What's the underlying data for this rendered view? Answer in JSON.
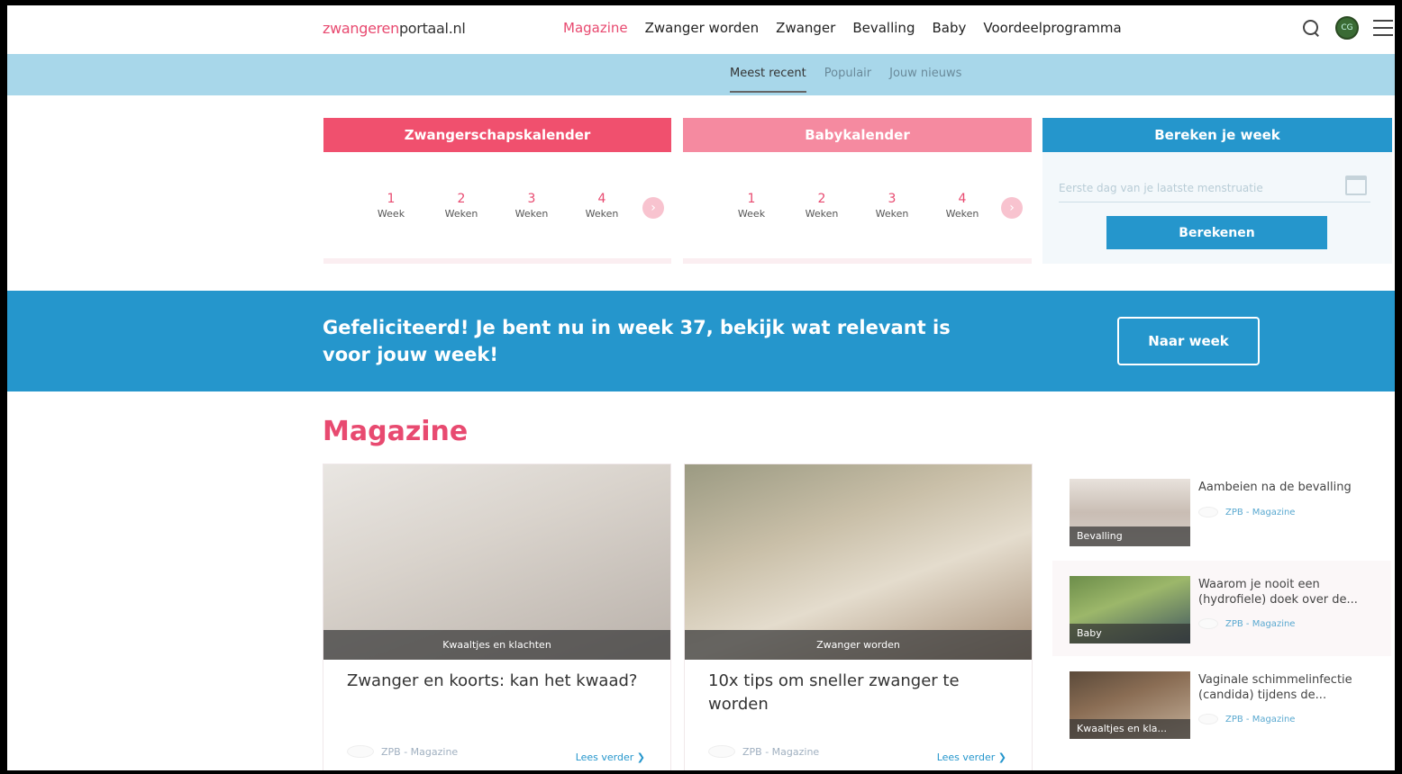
{
  "header": {
    "logo_pink": "zwangeren",
    "logo_dark": "portaal.nl",
    "nav": [
      "Magazine",
      "Zwanger worden",
      "Zwanger",
      "Bevalling",
      "Baby",
      "Voordeelprogramma"
    ],
    "avatar_initials": "CG"
  },
  "subnav": {
    "tabs": [
      "Meest recent",
      "Populair",
      "Jouw nieuws"
    ]
  },
  "pregnancy_calendar": {
    "title": "Zwangerschapskalender",
    "weeks": [
      {
        "num": "1",
        "label": "Week"
      },
      {
        "num": "2",
        "label": "Weken"
      },
      {
        "num": "3",
        "label": "Weken"
      },
      {
        "num": "4",
        "label": "Weken"
      }
    ],
    "next": "›"
  },
  "baby_calendar": {
    "title": "Babykalender",
    "weeks": [
      {
        "num": "1",
        "label": "Week"
      },
      {
        "num": "2",
        "label": "Weken"
      },
      {
        "num": "3",
        "label": "Weken"
      },
      {
        "num": "4",
        "label": "Weken"
      }
    ],
    "next": "›"
  },
  "week_calc": {
    "title": "Bereken je week",
    "placeholder": "Eerste dag van je laatste menstruatie",
    "button": "Berekenen"
  },
  "banner": {
    "message": "Gefeliciteerd! Je bent nu in week 37, bekijk wat relevant is voor jouw week!",
    "button": "Naar week"
  },
  "magazine": {
    "title": "Magazine",
    "articles": [
      {
        "category": "Kwaaltjes en klachten",
        "title": "Zwanger en koorts: kan het kwaad?",
        "source": "ZPB - Magazine",
        "more": "Lees verder ❯"
      },
      {
        "category": "Zwanger worden",
        "title": "10x tips om sneller zwanger te worden",
        "source": "ZPB - Magazine",
        "more": "Lees verder ❯"
      }
    ],
    "side": [
      {
        "category": "Bevalling",
        "title": "Aambeien na de bevalling",
        "source": "ZPB - Magazine"
      },
      {
        "category": "Baby",
        "title": "Waarom je nooit een (hydrofiele) doek over de...",
        "source": "ZPB - Magazine"
      },
      {
        "category": "Kwaaltjes en kla...",
        "title": "Vaginale schimmelinfectie (candida) tijdens de...",
        "source": "ZPB - Magazine"
      }
    ]
  }
}
